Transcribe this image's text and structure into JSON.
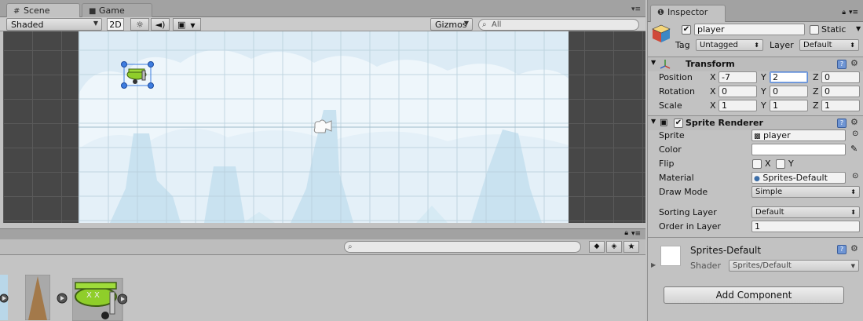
{
  "scene_tabs": [
    {
      "label": "Scene",
      "icon": "hash-icon"
    },
    {
      "label": "Game",
      "icon": "game-controller-icon"
    }
  ],
  "toolbar": {
    "shading_mode": "Shaded",
    "mode_2d": "2D",
    "gizmos": "Gizmos",
    "search_placeholder": "All"
  },
  "inspector": {
    "tab_label": "Inspector",
    "object": {
      "name": "player",
      "active": true,
      "static_label": "Static",
      "tag_label": "Tag",
      "tag_value": "Untagged",
      "layer_label": "Layer",
      "layer_value": "Default"
    },
    "transform": {
      "title": "Transform",
      "position": {
        "label": "Position",
        "x": "-7",
        "y": "2",
        "z": "0"
      },
      "rotation": {
        "label": "Rotation",
        "x": "0",
        "y": "0",
        "z": "0"
      },
      "scale": {
        "label": "Scale",
        "x": "1",
        "y": "1",
        "z": "1"
      },
      "axis_x": "X",
      "axis_y": "Y",
      "axis_z": "Z"
    },
    "sprite_renderer": {
      "title": "Sprite Renderer",
      "sprite_label": "Sprite",
      "sprite_value": "player",
      "color_label": "Color",
      "color_value": "#ffffff",
      "flip_label": "Flip",
      "flip_x": "X",
      "flip_y": "Y",
      "material_label": "Material",
      "material_value": "Sprites-Default",
      "draw_mode_label": "Draw Mode",
      "draw_mode_value": "Simple",
      "sorting_layer_label": "Sorting Layer",
      "sorting_layer_value": "Default",
      "order_label": "Order in Layer",
      "order_value": "1"
    },
    "material": {
      "name": "Sprites-Default",
      "shader_label": "Shader",
      "shader_value": "Sprites/Default"
    },
    "add_component": "Add Component"
  },
  "colors": {
    "sky": "#dcebf5",
    "selection": "#3e7de0",
    "player_green": "#8fce2a"
  }
}
